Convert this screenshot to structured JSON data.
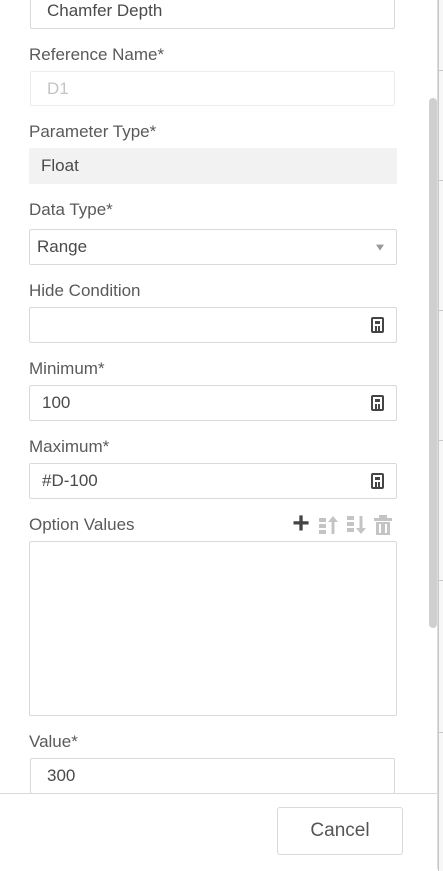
{
  "form": {
    "parameter_name_value": "Chamfer Depth",
    "reference_name": {
      "label": "Reference Name*",
      "placeholder": "D1"
    },
    "parameter_type": {
      "label": "Parameter Type*",
      "value": "Float"
    },
    "data_type": {
      "label": "Data Type*",
      "value": "Range"
    },
    "hide_condition": {
      "label": "Hide Condition",
      "value": ""
    },
    "minimum": {
      "label": "Minimum*",
      "value": "100"
    },
    "maximum": {
      "label": "Maximum*",
      "value": "#D-100"
    },
    "option_values": {
      "label": "Option Values"
    },
    "value": {
      "label": "Value*",
      "value": "300"
    }
  },
  "icons": {
    "calculator": "calculator-icon",
    "add": "plus-icon",
    "move_up": "move-up-icon",
    "move_down": "move-down-icon",
    "delete": "trash-icon"
  },
  "footer": {
    "cancel_label": "Cancel"
  },
  "colors": {
    "disabled_icon": "#c4c4c4",
    "active_icon": "#444444",
    "readonly_bg": "#f2f2f2"
  }
}
